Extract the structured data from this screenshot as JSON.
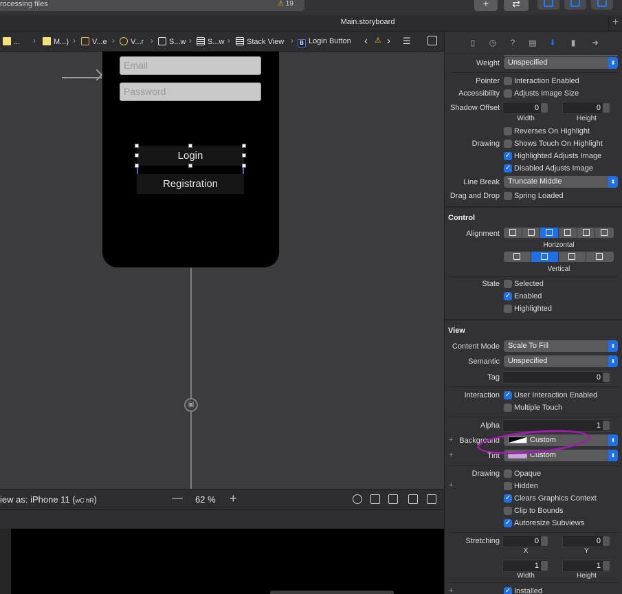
{
  "toolbar": {
    "status": "rocessing files",
    "warning_count": "19",
    "add_label": "+",
    "swap_label": "⇄",
    "colors": {
      "accent": "#1f6fe8"
    }
  },
  "tabbar": {
    "main_tab": "Main.storyboard",
    "add_tab": "+"
  },
  "breadcrumbs": {
    "items": [
      {
        "label": "...",
        "icon": "file-icon"
      },
      {
        "label": "M...)",
        "icon": "folder-file-icon"
      },
      {
        "label": "V...e",
        "icon": "storyboard-scene-icon"
      },
      {
        "label": "V...r",
        "icon": "view-controller-icon"
      },
      {
        "label": "S...w",
        "icon": "view-icon"
      },
      {
        "label": "S...w",
        "icon": "stack-view-icon"
      },
      {
        "label": "Stack View",
        "icon": "stack-view-icon"
      },
      {
        "label": "Login Button",
        "icon": "button-icon"
      }
    ],
    "button_badge": "B"
  },
  "canvas": {
    "email_placeholder": "Email",
    "password_placeholder": "Password",
    "login_label": "Login",
    "registration_label": "Registration"
  },
  "bottombar": {
    "view_as": "iew as: iPhone 11 (",
    "size_class": "wC hR",
    "close_paren": ")",
    "zoom": "62 %",
    "zoom_out": "—",
    "zoom_in": "+"
  },
  "inspector": {
    "weight_label": "Weight",
    "weight_value": "Unspecified",
    "pointer_label": "Pointer",
    "pointer_value": "Interaction Enabled",
    "accessibility_label": "Accessibility",
    "accessibility_value": "Adjusts Image Size",
    "shadow_label": "Shadow Offset",
    "shadow_width": "0",
    "shadow_height": "0",
    "width_label": "Width",
    "height_label": "Height",
    "reverses": "Reverses On Highlight",
    "drawing_label": "Drawing",
    "shows_touch": "Shows Touch On Highlight",
    "highlighted_adjusts": "Highlighted Adjusts Image",
    "disabled_adjusts": "Disabled Adjusts Image",
    "linebreak_label": "Line Break",
    "linebreak_value": "Truncate Middle",
    "dragdrop_label": "Drag and Drop",
    "spring_loaded": "Spring Loaded",
    "control_section": "Control",
    "alignment_label": "Alignment",
    "horizontal_label": "Horizontal",
    "vertical_label": "Vertical",
    "state_label": "State",
    "selected": "Selected",
    "enabled": "Enabled",
    "highlighted": "Highlighted",
    "view_section": "View",
    "content_mode_label": "Content Mode",
    "content_mode_value": "Scale To Fill",
    "semantic_label": "Semantic",
    "semantic_value": "Unspecified",
    "tag_label": "Tag",
    "tag_value": "0",
    "interaction_label": "Interaction",
    "user_interaction": "User Interaction Enabled",
    "multiple_touch": "Multiple Touch",
    "alpha_label": "Alpha",
    "alpha_value": "1",
    "background_label": "Background",
    "background_value": "Custom",
    "tint_label": "Tint",
    "tint_value": "Custom",
    "drawing2_label": "Drawing",
    "opaque": "Opaque",
    "hidden": "Hidden",
    "clears_context": "Clears Graphics Context",
    "clip_bounds": "Clip to Bounds",
    "autoresize": "Autoresize Subviews",
    "stretching_label": "Stretching",
    "stretch_x": "0",
    "stretch_y": "0",
    "x_label": "X",
    "y_label": "Y",
    "stretch_w": "1",
    "stretch_h": "1",
    "installed": "Installed"
  }
}
